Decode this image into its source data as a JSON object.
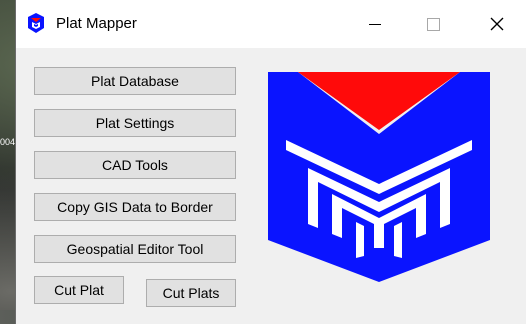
{
  "window": {
    "title": "Plat Mapper",
    "controls": {
      "minimize": "minimize",
      "maximize": "maximize",
      "close": "✕"
    }
  },
  "background": {
    "partial_text": "004"
  },
  "buttons": {
    "plat_database": "Plat Database",
    "plat_settings": "Plat Settings",
    "cad_tools": "CAD Tools",
    "copy_gis": "Copy GIS Data to Border",
    "geospatial_editor": "Geospatial Editor Tool",
    "cut_plat": "Cut Plat",
    "cut_plats": "Cut Plats"
  },
  "logo": {
    "icon": "pm-logo-icon",
    "colors": {
      "blue": "#0a14ff",
      "red": "#ff0a0a"
    }
  }
}
